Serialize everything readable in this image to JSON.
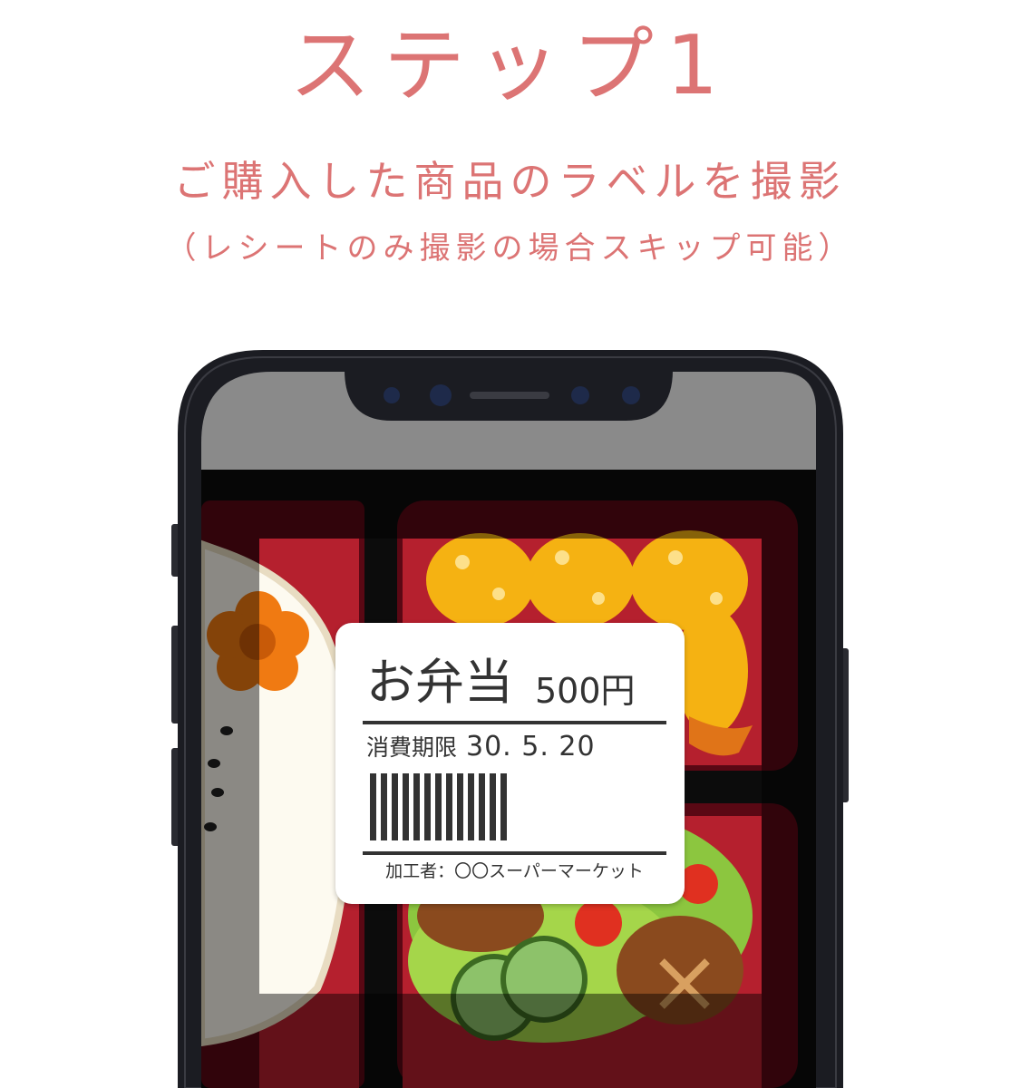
{
  "header": {
    "step_title": "ステップ1",
    "subtitle": "ご購入した商品のラベルを撮影",
    "note": "（レシートのみ撮影の場合スキップ可能）"
  },
  "label": {
    "product_name": "お弁当",
    "price": "500円",
    "expiry_label": "消費期限",
    "expiry_date": "30. 5. 20",
    "processor": "加工者：〇〇スーパーマーケット"
  },
  "colors": {
    "accent": "#dc7474",
    "phone_frame": "#1b1c22",
    "bento_tray": "#b5202e",
    "label_text": "#333333"
  }
}
